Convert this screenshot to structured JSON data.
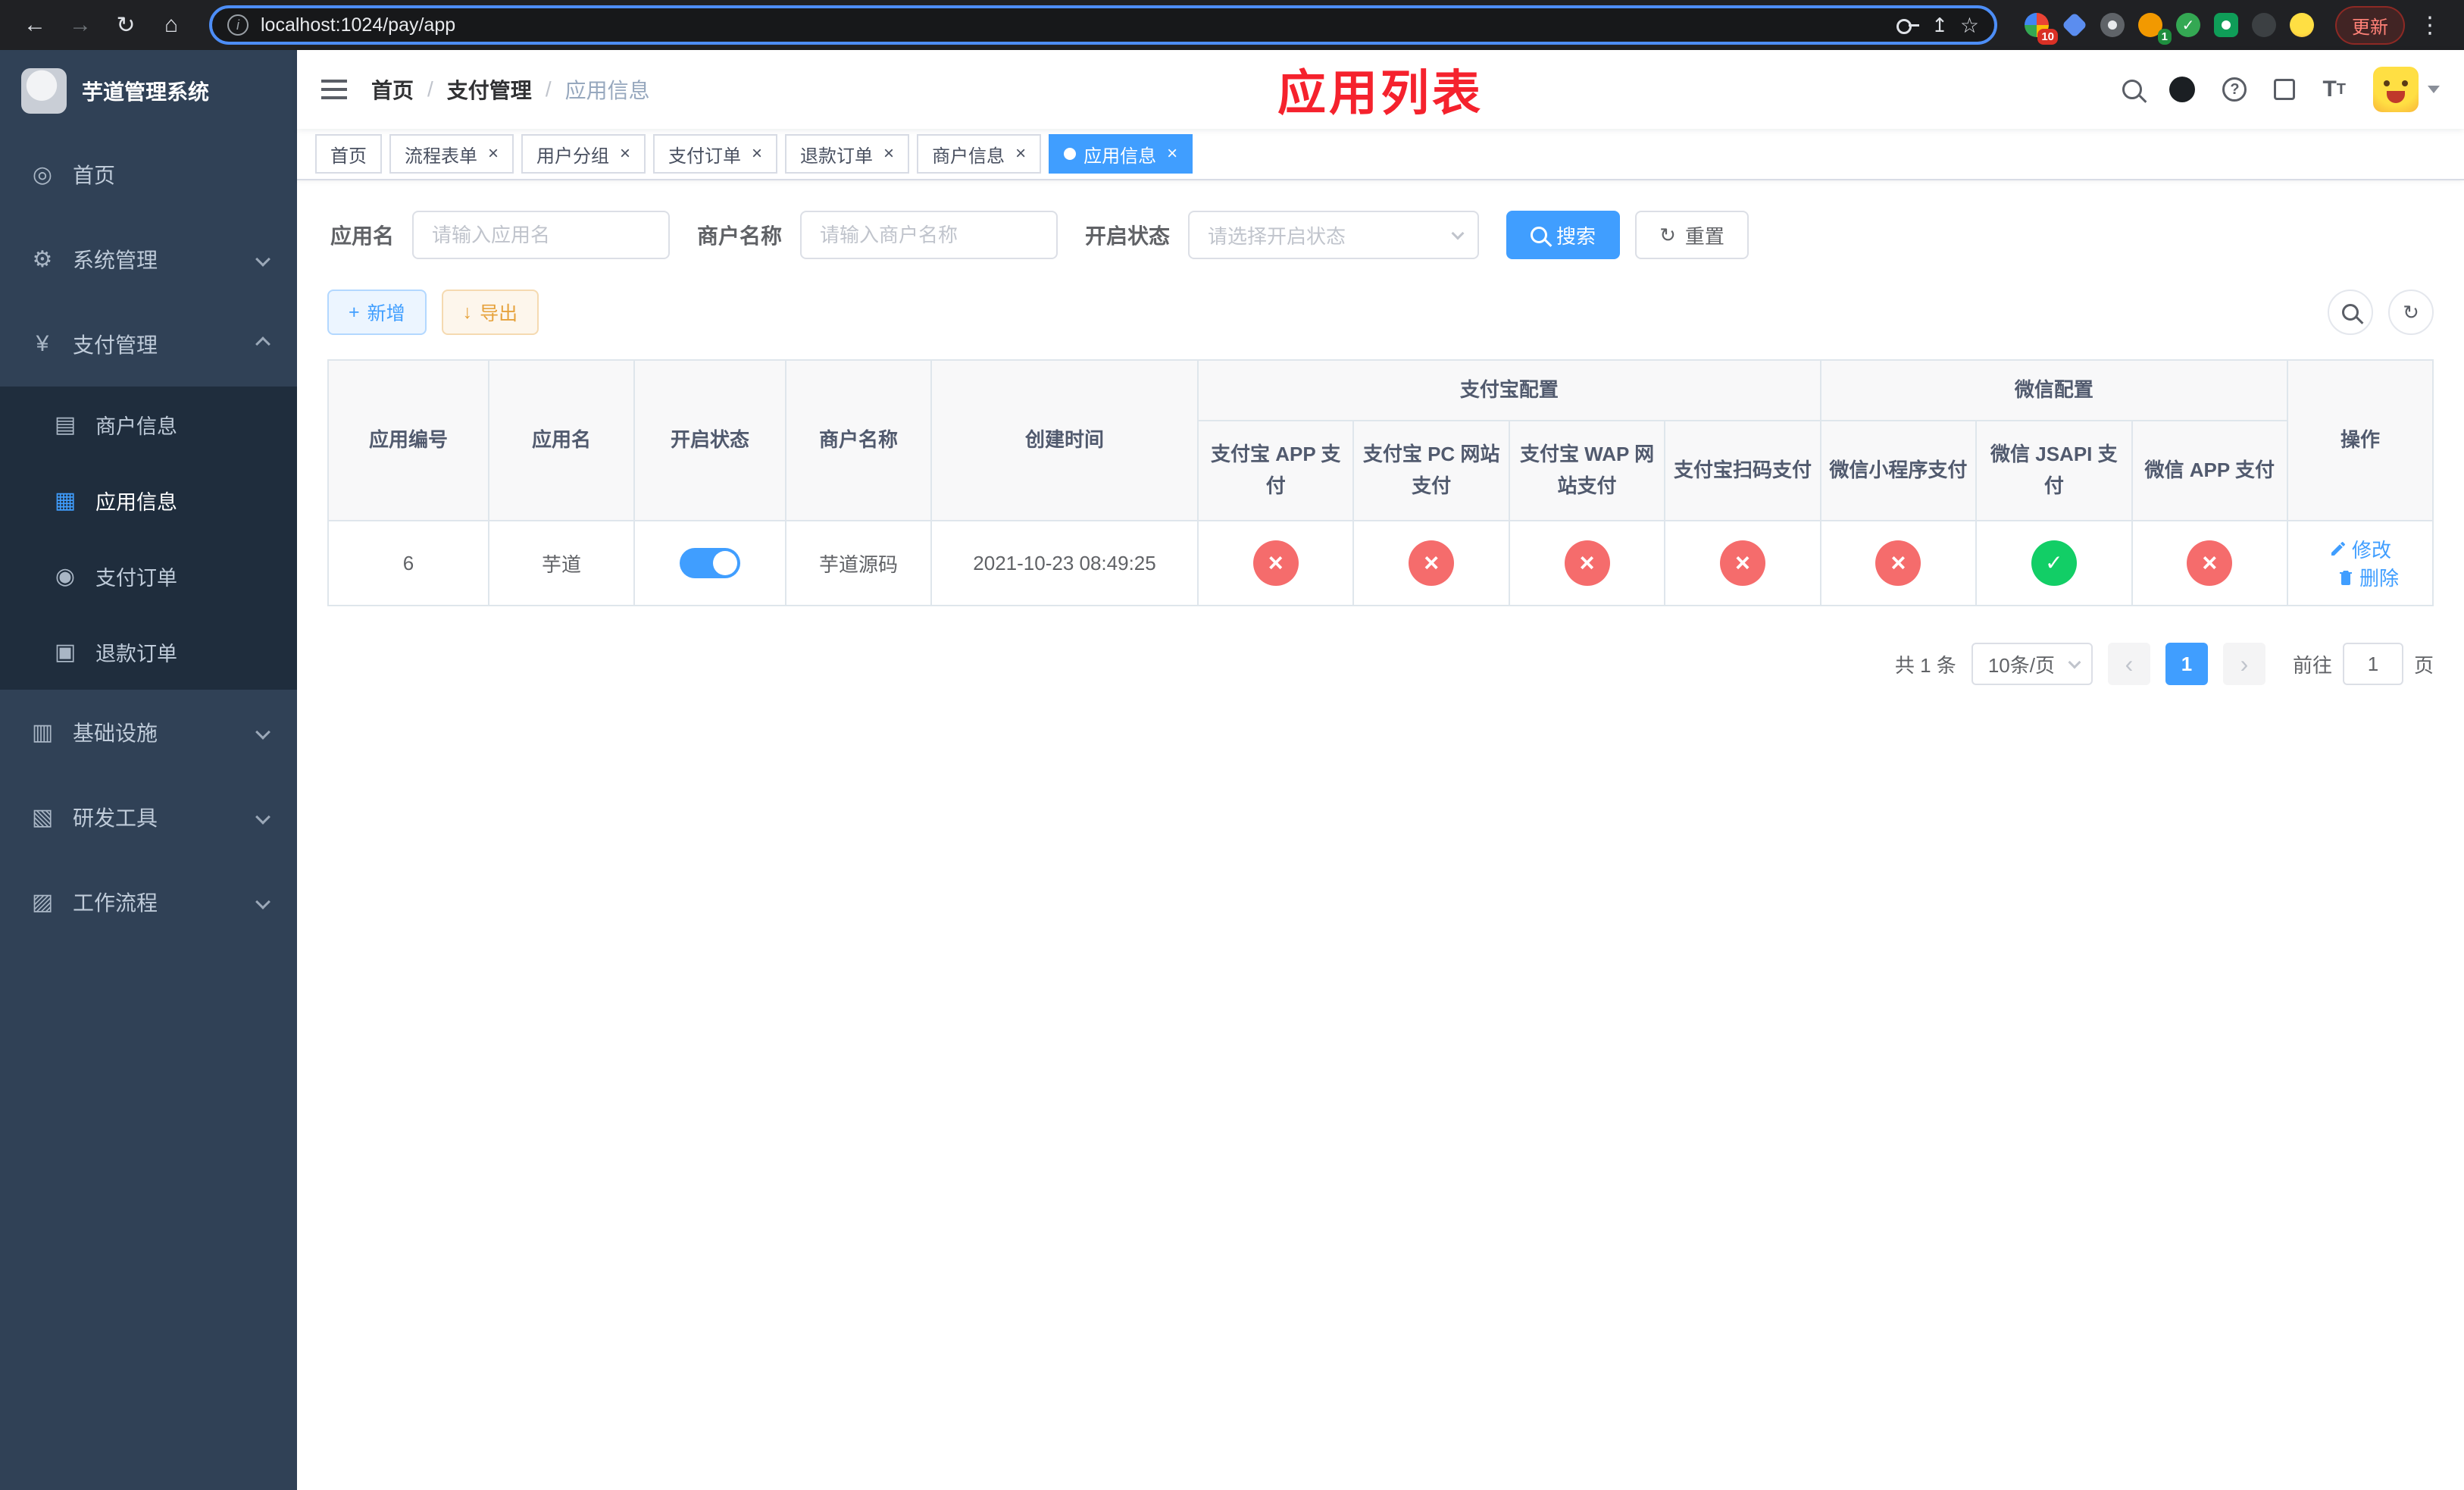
{
  "browser": {
    "url": "localhost:1024/pay/app",
    "update_button": "更新",
    "ext_badge_1": "10",
    "ext_badge_2": "1"
  },
  "app": {
    "page_overlay_title": "应用列表"
  },
  "sidebar": {
    "logo_title": "芋道管理系统",
    "home": "首页",
    "system": "系统管理",
    "payment": "支付管理",
    "merchant_info": "商户信息",
    "app_info": "应用信息",
    "pay_order": "支付订单",
    "refund_order": "退款订单",
    "infra": "基础设施",
    "dev_tools": "研发工具",
    "workflow": "工作流程"
  },
  "breadcrumb": [
    "首页",
    "支付管理",
    "应用信息"
  ],
  "tabs": [
    {
      "label": "首页"
    },
    {
      "label": "流程表单"
    },
    {
      "label": "用户分组"
    },
    {
      "label": "支付订单"
    },
    {
      "label": "退款订单"
    },
    {
      "label": "商户信息"
    },
    {
      "label": "应用信息"
    }
  ],
  "filters": {
    "app_name_label": "应用名",
    "app_name_placeholder": "请输入应用名",
    "merchant_label": "商户名称",
    "merchant_placeholder": "请输入商户名称",
    "status_label": "开启状态",
    "status_placeholder": "请选择开启状态",
    "search_label": "搜索",
    "reset_label": "重置"
  },
  "toolbar": {
    "add_label": "新增",
    "export_label": "导出"
  },
  "table": {
    "headers": {
      "app_id": "应用编号",
      "app_name": "应用名",
      "status": "开启状态",
      "merchant": "商户名称",
      "created": "创建时间",
      "alipay_group": "支付宝配置",
      "wechat_group": "微信配置",
      "alipay_app": "支付宝 APP 支付",
      "alipay_pc": "支付宝 PC 网站支付",
      "alipay_wap": "支付宝 WAP 网站支付",
      "alipay_qr": "支付宝扫码支付",
      "wx_mini": "微信小程序支付",
      "wx_jsapi": "微信 JSAPI 支付",
      "wx_app": "微信 APP 支付",
      "actions": "操作"
    },
    "rows": [
      {
        "app_id": "6",
        "app_name": "芋道",
        "status_on": true,
        "merchant": "芋道源码",
        "created": "2021-10-23 08:49:25",
        "alipay_app": false,
        "alipay_pc": false,
        "alipay_wap": false,
        "alipay_qr": false,
        "wx_mini": false,
        "wx_jsapi": true,
        "wx_app": false,
        "edit_label": "修改",
        "delete_label": "删除"
      }
    ]
  },
  "pagination": {
    "total": "共 1 条",
    "page_size": "10条/页",
    "page": "1",
    "goto_prefix": "前往",
    "goto_value": "1",
    "goto_suffix": "页"
  },
  "colors": {
    "accent": "#409eff",
    "danger": "#f56c6c",
    "success": "#12ce66",
    "warning": "#e6a23c",
    "sidebar_bg": "#304156",
    "submenu_bg": "#1f2d3d",
    "title_red": "#f5222d"
  }
}
